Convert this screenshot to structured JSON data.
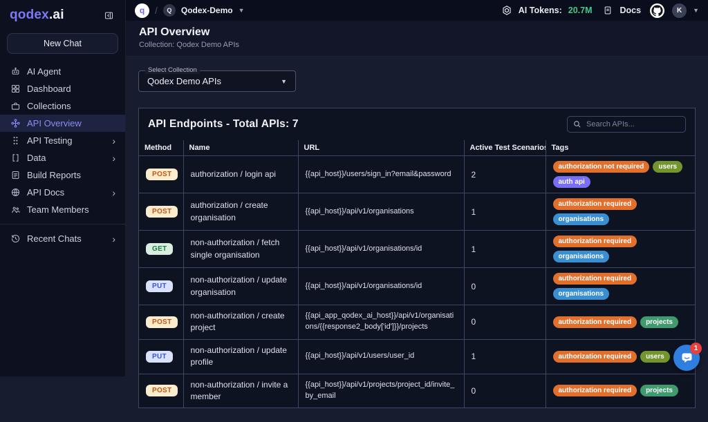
{
  "sidebar": {
    "logo_brand": "qodex",
    "logo_suffix": ".ai",
    "new_chat_label": "New Chat",
    "items": [
      {
        "label": "AI Agent",
        "icon": "robot-icon"
      },
      {
        "label": "Dashboard",
        "icon": "dashboard-icon"
      },
      {
        "label": "Collections",
        "icon": "collections-icon"
      },
      {
        "label": "API Overview",
        "icon": "api-overview-icon",
        "active": true
      },
      {
        "label": "API Testing",
        "icon": "api-testing-icon",
        "chevron": true
      },
      {
        "label": "Data",
        "icon": "data-brackets-icon",
        "chevron": true
      },
      {
        "label": "Build Reports",
        "icon": "build-reports-icon"
      },
      {
        "label": "API Docs",
        "icon": "api-docs-icon",
        "chevron": true
      },
      {
        "label": "Team Members",
        "icon": "team-members-icon"
      },
      {
        "label": "Recent Chats",
        "icon": "recent-chats-icon",
        "chevron": true,
        "divider_before": true
      }
    ]
  },
  "topbar": {
    "workspace_initial": "q",
    "breadcrumb_separator": "/",
    "project_initial": "Q",
    "project_name": "Qodex-Demo",
    "ai_tokens_label": "AI Tokens:",
    "ai_tokens_value": "20.7M",
    "ai_tokens_color": "#41c98a",
    "docs_label": "Docs",
    "avatar_initial": "K"
  },
  "page_header": {
    "title": "API Overview",
    "subtitle": "Collection: Qodex Demo APIs"
  },
  "collection_select": {
    "label": "Select Collection",
    "value": "Qodex Demo APIs"
  },
  "endpoints_panel": {
    "title": "API Endpoints - Total APIs: 7",
    "search_placeholder": "Search APIs...",
    "columns": [
      "Method",
      "Name",
      "URL",
      "Active Test Scenarios",
      "Tags"
    ],
    "method_styles": {
      "POST": {
        "bg": "#faeccc",
        "fg": "#c05717"
      },
      "GET": {
        "bg": "#d8eedf",
        "fg": "#1e7a44"
      },
      "PUT": {
        "bg": "#d9e2fa",
        "fg": "#3a55cf"
      }
    },
    "rows": [
      {
        "method": "POST",
        "name": "authorization / login api",
        "url": "{{api_host}}/users/sign_in?email&password",
        "scenarios": "2",
        "tags": [
          {
            "label": "authorization not required",
            "color": "#e2702d"
          },
          {
            "label": "users",
            "color": "#74942e"
          },
          {
            "label": "auth api",
            "color": "#7a6ef4"
          }
        ]
      },
      {
        "method": "POST",
        "name": "authorization / create organisation",
        "url": "{{api_host}}/api/v1/organisations",
        "scenarios": "1",
        "tags": [
          {
            "label": "authorization required",
            "color": "#e2702d"
          },
          {
            "label": "organisations",
            "color": "#3a8fd1"
          }
        ]
      },
      {
        "method": "GET",
        "name": "non-authorization / fetch single organisation",
        "url": "{{api_host}}/api/v1/organisations/id",
        "scenarios": "1",
        "tags": [
          {
            "label": "authorization required",
            "color": "#e2702d"
          },
          {
            "label": "organisations",
            "color": "#3a8fd1"
          }
        ]
      },
      {
        "method": "PUT",
        "name": "non-authorization / update organisation",
        "url": "{{api_host}}/api/v1/organisations/id",
        "scenarios": "0",
        "tags": [
          {
            "label": "authorization required",
            "color": "#e2702d"
          },
          {
            "label": "organisations",
            "color": "#3a8fd1"
          }
        ]
      },
      {
        "method": "POST",
        "name": "non-authorization / create project",
        "url": "{{api_app_qodex_ai_host}}/api/v1/organisations/{{response2_body['id']}}/projects",
        "scenarios": "0",
        "tags": [
          {
            "label": "authorization required",
            "color": "#e2702d"
          },
          {
            "label": "projects",
            "color": "#3f9b6e"
          }
        ]
      },
      {
        "method": "PUT",
        "name": "non-authorization / update profile",
        "url": "{{api_host}}/api/v1/users/user_id",
        "scenarios": "1",
        "tags": [
          {
            "label": "authorization required",
            "color": "#e2702d"
          },
          {
            "label": "users",
            "color": "#74942e"
          }
        ]
      },
      {
        "method": "POST",
        "name": "non-authorization / invite a member",
        "url": "{{api_host}}/api/v1/projects/project_id/invite_by_email",
        "scenarios": "0",
        "tags": [
          {
            "label": "authorization required",
            "color": "#e2702d"
          },
          {
            "label": "projects",
            "color": "#3f9b6e"
          }
        ]
      }
    ]
  },
  "chat_widget": {
    "badge": "1"
  }
}
